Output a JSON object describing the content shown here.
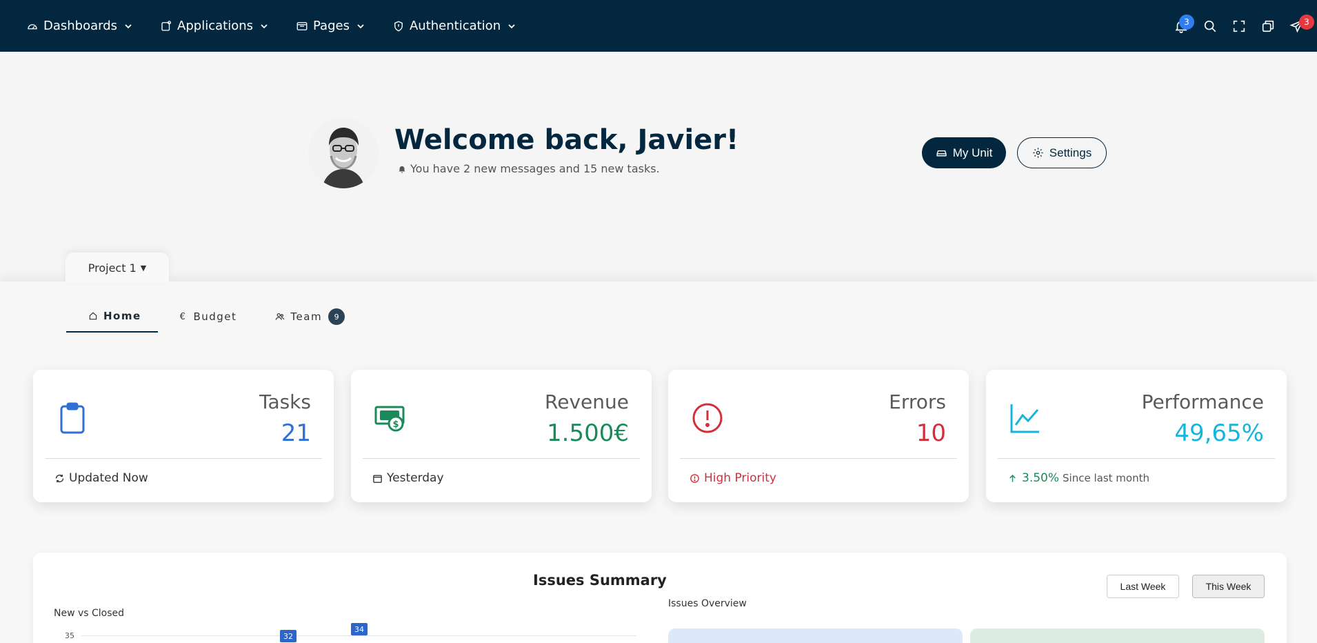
{
  "nav": {
    "items": [
      {
        "label": "Dashboards",
        "icon": "gauge-icon"
      },
      {
        "label": "Applications",
        "icon": "app-icon"
      },
      {
        "label": "Pages",
        "icon": "pages-icon"
      },
      {
        "label": "Authentication",
        "icon": "shield-icon"
      }
    ],
    "notifications_count": "3",
    "messages_count": "3"
  },
  "hero": {
    "welcome": "Welcome back, Javier!",
    "subtext": "You have 2 new messages and 15 new tasks.",
    "my_unit_label": "My Unit",
    "settings_label": "Settings"
  },
  "project": {
    "selected": "Project 1"
  },
  "tabs": [
    {
      "label": "Home",
      "icon": "home-icon",
      "active": true
    },
    {
      "label": "Budget",
      "icon": "euro-icon"
    },
    {
      "label": "Team",
      "icon": "users-icon",
      "count": "9"
    }
  ],
  "cards": [
    {
      "title": "Tasks",
      "value": "21",
      "footer": "Updated Now",
      "color": "#2f6fd6",
      "icon": "clipboard-icon",
      "footer_icon": "refresh-icon"
    },
    {
      "title": "Revenue",
      "value": "1.500€",
      "footer": "Yesterday",
      "color": "#1a8a5a",
      "icon": "money-icon",
      "footer_icon": "calendar-icon"
    },
    {
      "title": "Errors",
      "value": "10",
      "footer": "High Priority",
      "color": "#d32f3a",
      "icon": "alert-circle-icon",
      "footer_icon": "alert-small-icon"
    },
    {
      "title": "Performance",
      "value": "49,65%",
      "footer_change": "3.50%",
      "footer": "Since last month",
      "color": "#16b6dc",
      "icon": "chart-line-icon",
      "footer_icon": "arrow-up-icon"
    }
  ],
  "issues": {
    "title": "Issues Summary",
    "last_week": "Last Week",
    "this_week": "This Week",
    "chart_label": "New vs Closed",
    "overview_label": "Issues Overview",
    "tick_top": "35",
    "data_tags": [
      "32",
      "34"
    ]
  }
}
